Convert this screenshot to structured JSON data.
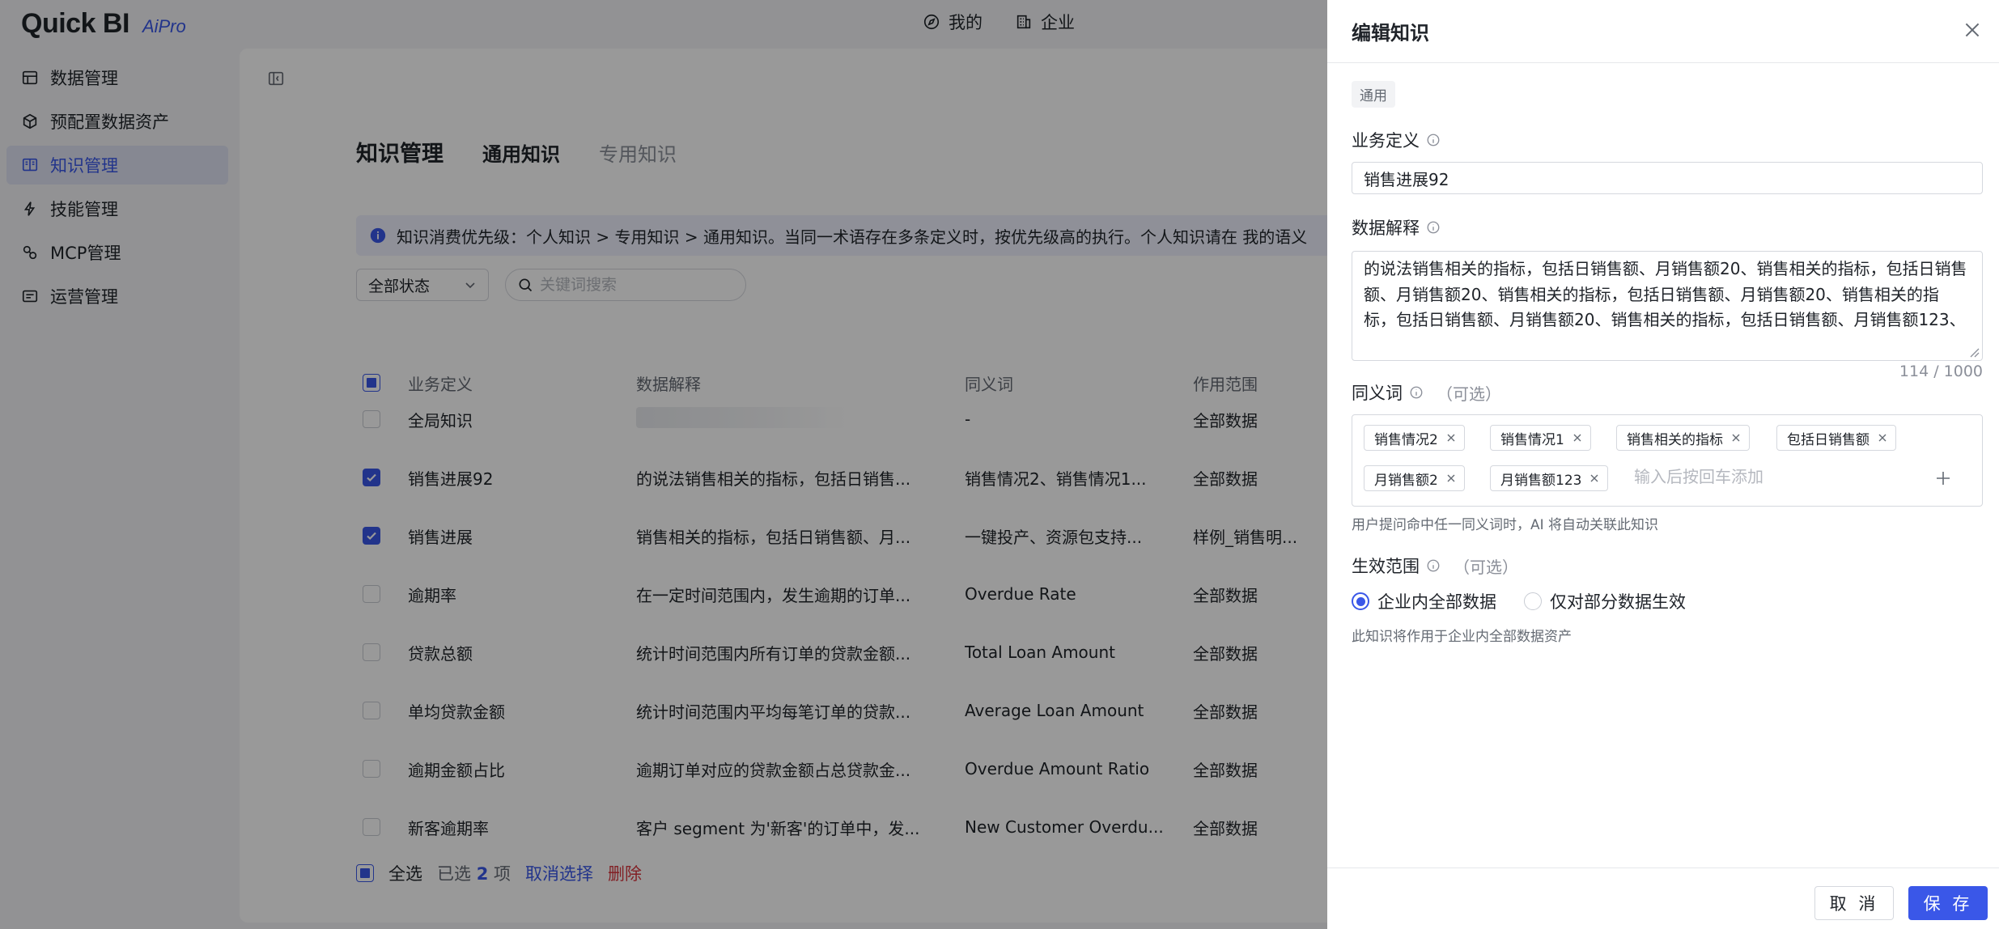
{
  "app": {
    "logo": "Quick BI",
    "logo_sub": "AiPro"
  },
  "top_nav": [
    {
      "label": "我的",
      "icon": "compass-icon"
    },
    {
      "label": "企业",
      "icon": "building-icon"
    }
  ],
  "sidebar": {
    "items": [
      {
        "label": "数据管理",
        "icon": "data-icon"
      },
      {
        "label": "预配置数据资产",
        "icon": "cube-icon"
      },
      {
        "label": "知识管理",
        "icon": "book-icon",
        "active": true
      },
      {
        "label": "技能管理",
        "icon": "lightning-icon"
      },
      {
        "label": "MCP管理",
        "icon": "plugin-icon"
      },
      {
        "label": "运营管理",
        "icon": "list-icon"
      }
    ]
  },
  "page": {
    "title": "知识管理",
    "tabs": [
      {
        "label": "通用知识",
        "active": true
      },
      {
        "label": "专用知识",
        "active": false
      }
    ],
    "notice": "知识消费优先级：个人知识 > 专用知识 > 通用知识。当同一术语存在多条定义时，按优先级高的执行。个人知识请在 我的语义",
    "filter": {
      "status": "全部状态",
      "search_placeholder": "关键词搜索"
    }
  },
  "table": {
    "columns": [
      "业务定义",
      "数据解释",
      "同义词",
      "作用范围"
    ],
    "rows": [
      {
        "name": "全局知识",
        "desc": "",
        "syn": "-",
        "scope": "全部数据",
        "checked": false
      },
      {
        "name": "销售进展92",
        "desc": "的说法销售相关的指标，包括日销售...",
        "syn": "销售情况2、销售情况1...",
        "scope": "全部数据",
        "checked": true
      },
      {
        "name": "销售进展",
        "desc": "销售相关的指标，包括日销售额、月...",
        "syn": "一键投产、资源包支持...",
        "scope": "样例_销售明...",
        "checked": true
      },
      {
        "name": "逾期率",
        "desc": "在一定时间范围内，发生逾期的订单...",
        "syn": "Overdue Rate",
        "scope": "全部数据",
        "checked": false
      },
      {
        "name": "贷款总额",
        "desc": "统计时间范围内所有订单的贷款金额...",
        "syn": "Total Loan Amount",
        "scope": "全部数据",
        "checked": false
      },
      {
        "name": "单均贷款金额",
        "desc": "统计时间范围内平均每笔订单的贷款...",
        "syn": "Average Loan Amount",
        "scope": "全部数据",
        "checked": false
      },
      {
        "name": "逾期金额占比",
        "desc": "逾期订单对应的贷款金额占总贷款金...",
        "syn": "Overdue Amount Ratio",
        "scope": "全部数据",
        "checked": false
      },
      {
        "name": "新客逾期率",
        "desc": "客户 segment 为'新客'的订单中，发...",
        "syn": "New Customer Overdu...",
        "scope": "全部数据",
        "checked": false
      }
    ]
  },
  "footer": {
    "select_all": "全选",
    "selected_prefix": "已选",
    "selected_count": "2",
    "selected_suffix": "项",
    "cancel_selection": "取消选择",
    "delete": "删除"
  },
  "drawer": {
    "title": "编辑知识",
    "type_tag": "通用",
    "biz_def_label": "业务定义",
    "biz_def_value": "销售进展92",
    "data_expl_label": "数据解释",
    "data_expl_value": "的说法销售相关的指标，包括日销售额、月销售额20、销售相关的指标，包括日销售额、月销售额20、销售相关的指标，包括日销售额、月销售额20、销售相关的指标，包括日销售额、月销售额20、销售相关的指标，包括日销售额、月销售额123、",
    "char_count": "114 / 1000",
    "synonyms_label": "同义词",
    "optional": "（可选）",
    "synonyms": [
      "销售情况2",
      "销售情况1",
      "销售相关的指标",
      "包括日销售额",
      "月销售额2",
      "月销售额123"
    ],
    "synonym_placeholder": "输入后按回车添加",
    "synonym_hint": "用户提问命中任一同义词时，AI 将自动关联此知识",
    "scope_label": "生效范围",
    "scope_options": [
      {
        "label": "企业内全部数据",
        "selected": true
      },
      {
        "label": "仅对部分数据生效",
        "selected": false
      }
    ],
    "scope_hint": "此知识将作用于企业内全部数据资产",
    "cancel": "取 消",
    "save": "保 存"
  },
  "colors": {
    "accent": "#3a57e8",
    "danger": "#d9363e",
    "mask": "rgba(0,0,0,0.40)"
  }
}
